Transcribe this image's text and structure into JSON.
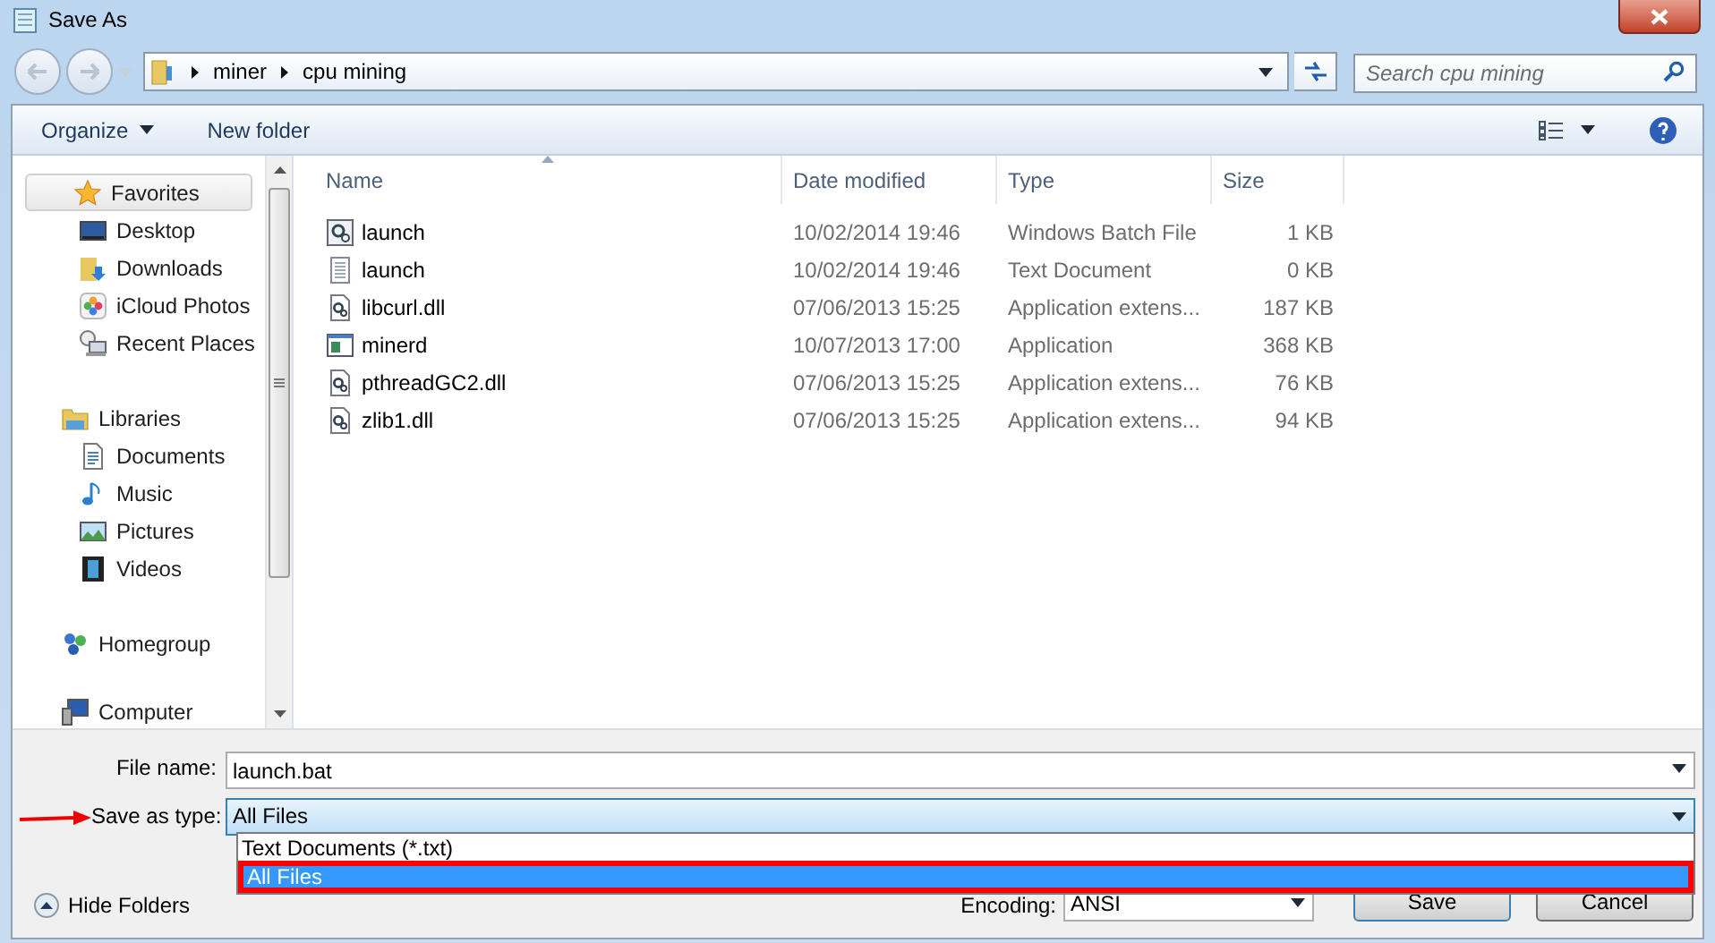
{
  "window": {
    "title": "Save As"
  },
  "breadcrumb": [
    "miner",
    "cpu mining"
  ],
  "search": {
    "placeholder": "Search cpu mining"
  },
  "toolbar": {
    "organize": "Organize",
    "new_folder": "New folder"
  },
  "nav": [
    {
      "label": "Favorites",
      "kind": "favorites",
      "selected": true,
      "children": [
        {
          "label": "Desktop",
          "kind": "desktop",
          "selected": false
        },
        {
          "label": "Downloads",
          "kind": "downloads",
          "selected": false
        },
        {
          "label": "iCloud Photos",
          "kind": "photos",
          "selected": false
        },
        {
          "label": "Recent Places",
          "kind": "recent",
          "selected": false
        }
      ]
    },
    {
      "label": "Libraries",
      "kind": "libraries",
      "selected": false,
      "children": [
        {
          "label": "Documents",
          "kind": "documents",
          "selected": false
        },
        {
          "label": "Music",
          "kind": "music",
          "selected": false
        },
        {
          "label": "Pictures",
          "kind": "pictures",
          "selected": false
        },
        {
          "label": "Videos",
          "kind": "videos",
          "selected": false
        }
      ]
    },
    {
      "label": "Homegroup",
      "kind": "homegroup",
      "selected": false
    },
    {
      "label": "Computer",
      "kind": "computer",
      "selected": false
    }
  ],
  "columns": [
    {
      "label": "Name",
      "sorted": true
    },
    {
      "label": "Date modified",
      "sorted": false
    },
    {
      "label": "Type",
      "sorted": false
    },
    {
      "label": "Size",
      "sorted": false
    }
  ],
  "rows": [
    {
      "name": "launch",
      "date": "10/02/2014 19:46",
      "type": "Windows Batch File",
      "size": "1 KB",
      "kind": "batch"
    },
    {
      "name": "launch",
      "date": "10/02/2014 19:46",
      "type": "Text Document",
      "size": "0 KB",
      "kind": "text"
    },
    {
      "name": "libcurl.dll",
      "date": "07/06/2013 15:25",
      "type": "Application extens...",
      "size": "187 KB",
      "kind": "dll"
    },
    {
      "name": "minerd",
      "date": "10/07/2013 17:00",
      "type": "Application",
      "size": "368 KB",
      "kind": "app"
    },
    {
      "name": "pthreadGC2.dll",
      "date": "07/06/2013 15:25",
      "type": "Application extens...",
      "size": "76 KB",
      "kind": "dll"
    },
    {
      "name": "zlib1.dll",
      "date": "07/06/2013 15:25",
      "type": "Application extens...",
      "size": "94 KB",
      "kind": "dll"
    }
  ],
  "file_name": {
    "label": "File name:",
    "value": "launch.bat"
  },
  "save_as_type": {
    "label": "Save as type:",
    "value": "All Files",
    "options": [
      {
        "label": "Text Documents (*.txt)",
        "selected": false
      },
      {
        "label": "All Files",
        "selected": true
      }
    ]
  },
  "hide_folders": "Hide Folders",
  "encoding": {
    "label": "Encoding:",
    "value": "ANSI"
  },
  "buttons": [
    "Save",
    "Cancel"
  ]
}
